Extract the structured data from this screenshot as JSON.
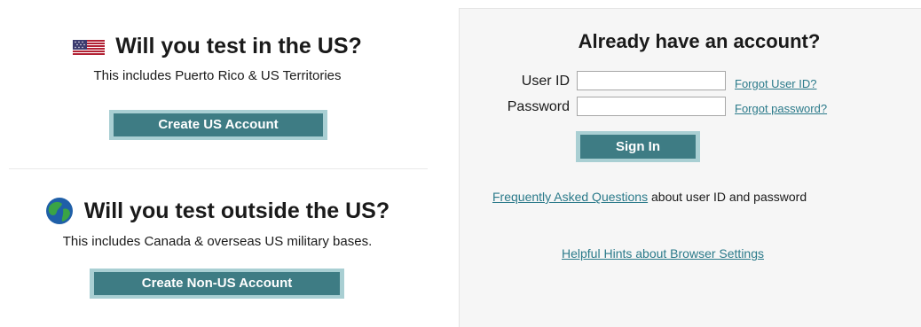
{
  "us": {
    "icon": "us-flag-icon",
    "heading": "Will you test in the US?",
    "subtitle": "This includes Puerto Rico & US Territories",
    "button_label": "Create US Account"
  },
  "non_us": {
    "icon": "globe-icon",
    "heading": "Will you test outside the US?",
    "subtitle": "This includes Canada & overseas US military bases.",
    "button_label": "Create Non-US Account"
  },
  "login": {
    "title": "Already have an account?",
    "user_id_label": "User ID",
    "user_id_value": "",
    "password_label": "Password",
    "password_value": "",
    "forgot_user_id": "Forgot User ID?",
    "forgot_password": "Forgot password?",
    "sign_in_label": "Sign In",
    "faq_link": "Frequently Asked Questions",
    "faq_suffix": " about user ID and password",
    "hints_link": "Helpful Hints about Browser Settings"
  },
  "colors": {
    "button_fill": "#3e7c84",
    "button_border": "#a9cfd3",
    "link": "#2b7a8a",
    "panel_bg": "#f6f6f6"
  }
}
